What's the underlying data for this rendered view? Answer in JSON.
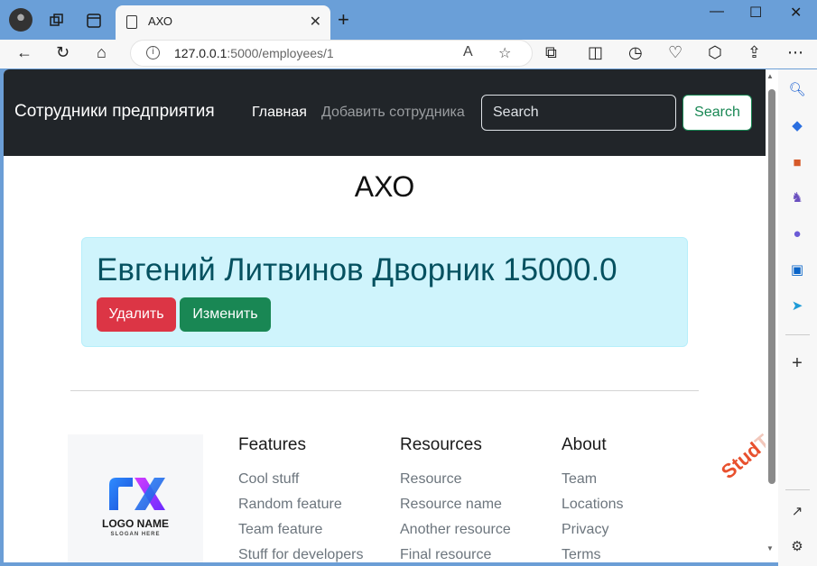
{
  "browser": {
    "tab_title": "АХО",
    "url_host": "127.0.0.1",
    "url_path": ":5000/employees/1"
  },
  "app": {
    "brand": "Сотрудники предприятия",
    "nav": {
      "home": "Главная",
      "add": "Добавить сотрудника"
    },
    "search": {
      "placeholder": "Search",
      "button": "Search"
    },
    "department": "АХО",
    "employee": {
      "text": "Евгений Литвинов Дворник 15000.0",
      "delete_label": "Удалить",
      "edit_label": "Изменить"
    }
  },
  "footer": {
    "logo": {
      "name": "LOGO NAME",
      "slogan": "SLOGAN HERE"
    },
    "columns": [
      {
        "title": "Features",
        "links": [
          "Cool stuff",
          "Random feature",
          "Team feature",
          "Stuff for developers"
        ]
      },
      {
        "title": "Resources",
        "links": [
          "Resource",
          "Resource name",
          "Another resource",
          "Final resource"
        ]
      },
      {
        "title": "About",
        "links": [
          "Team",
          "Locations",
          "Privacy",
          "Terms"
        ]
      }
    ]
  },
  "watermark": {
    "strong": "Stud",
    "faint": "Team"
  },
  "colors": {
    "danger": "#dc3545",
    "success": "#198754",
    "info_bg": "#cff4fc",
    "navbar": "#212529"
  }
}
